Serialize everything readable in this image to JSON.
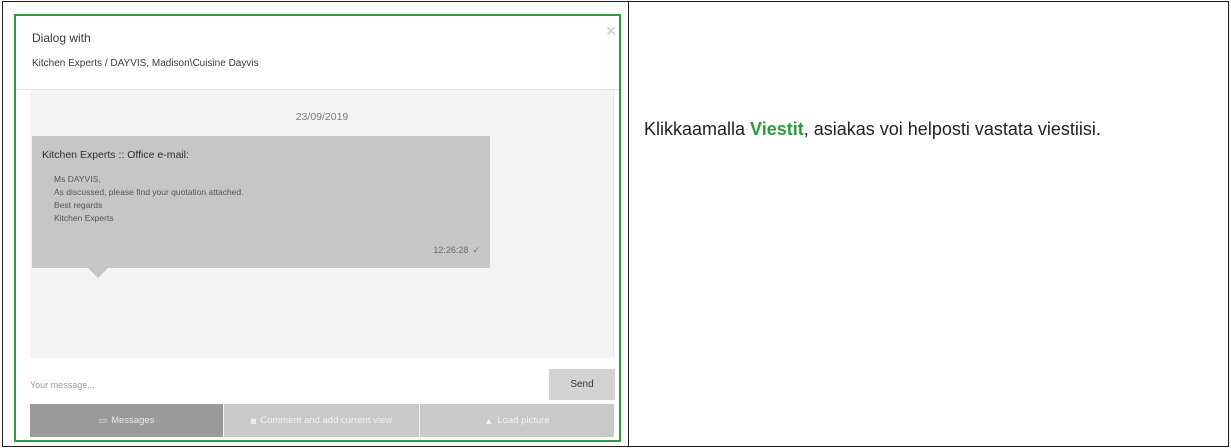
{
  "dialog": {
    "title": "Dialog with",
    "subtitle": "Kitchen Experts / DAYVIS, Madison\\Cuisine Dayvis",
    "close_icon": "close-icon"
  },
  "chat": {
    "date": "23/09/2019",
    "message": {
      "sender": "Kitchen Experts :: Office e-mail:",
      "lines": [
        "Ms DAYVIS,",
        "As discussed, please find your quotation attached.",
        "Best regards",
        "Kitchen Experts"
      ],
      "time": "12:26:28",
      "status_icon": "checkmark-icon"
    }
  },
  "composer": {
    "placeholder": "Your message...",
    "send_label": "Send"
  },
  "tabs": [
    {
      "label": "Messages",
      "icon": "chat-icon",
      "active": true
    },
    {
      "label": "Comment and add current view",
      "icon": "camera-icon",
      "active": false
    },
    {
      "label": "Load picture",
      "icon": "upload-icon",
      "active": false
    }
  ],
  "description": {
    "prefix": "Klikkaamalla ",
    "highlight": "Viestit",
    "suffix": ", asiakas voi helposti vastata viestiisi."
  },
  "colors": {
    "accent": "#2e9b3f",
    "bubble": "#c6c6c6",
    "tab_active": "#9a9a9a",
    "tab_inactive": "#c9c9c9"
  }
}
